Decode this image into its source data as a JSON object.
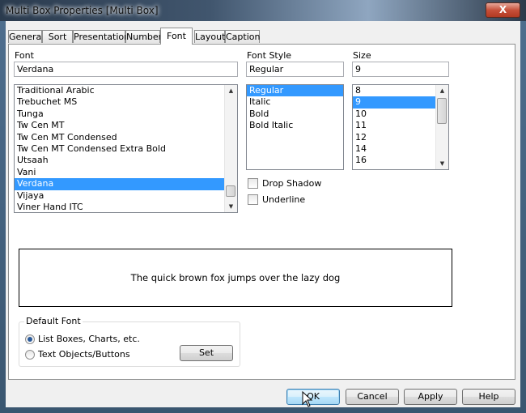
{
  "window": {
    "title": "Multi Box Properties [Multi Box]",
    "close_label": "X"
  },
  "tabs": [
    {
      "label": "General"
    },
    {
      "label": "Sort"
    },
    {
      "label": "Presentation"
    },
    {
      "label": "Number"
    },
    {
      "label": "Font"
    },
    {
      "label": "Layout"
    },
    {
      "label": "Caption"
    }
  ],
  "active_tab": "Font",
  "font": {
    "label": "Font",
    "value": "Verdana",
    "list": [
      "Traditional Arabic",
      "Trebuchet MS",
      "Tunga",
      "Tw Cen MT",
      "Tw Cen MT Condensed",
      "Tw Cen MT Condensed Extra Bold",
      "Utsaah",
      "Vani",
      "Verdana",
      "Vijaya",
      "Viner Hand ITC"
    ],
    "selected": "Verdana"
  },
  "font_style": {
    "label": "Font Style",
    "value": "Regular",
    "list": [
      "Regular",
      "Italic",
      "Bold",
      "Bold Italic"
    ],
    "selected": "Regular"
  },
  "size": {
    "label": "Size",
    "value": "9",
    "list": [
      "8",
      "9",
      "10",
      "11",
      "12",
      "14",
      "16"
    ],
    "selected": "9"
  },
  "effects": {
    "drop_shadow": {
      "label": "Drop Shadow",
      "checked": false
    },
    "underline": {
      "label": "Underline",
      "checked": false
    }
  },
  "preview_text": "The quick brown fox jumps over the lazy dog",
  "default_font": {
    "label": "Default Font",
    "options": [
      {
        "label": "List Boxes, Charts, etc.",
        "selected": true
      },
      {
        "label": "Text Objects/Buttons",
        "selected": false
      }
    ],
    "set_label": "Set"
  },
  "buttons": {
    "ok": "OK",
    "cancel": "Cancel",
    "apply": "Apply",
    "help": "Help"
  },
  "colors": {
    "selection": "#3399ff",
    "default_button_border": "#3c7fb1"
  }
}
